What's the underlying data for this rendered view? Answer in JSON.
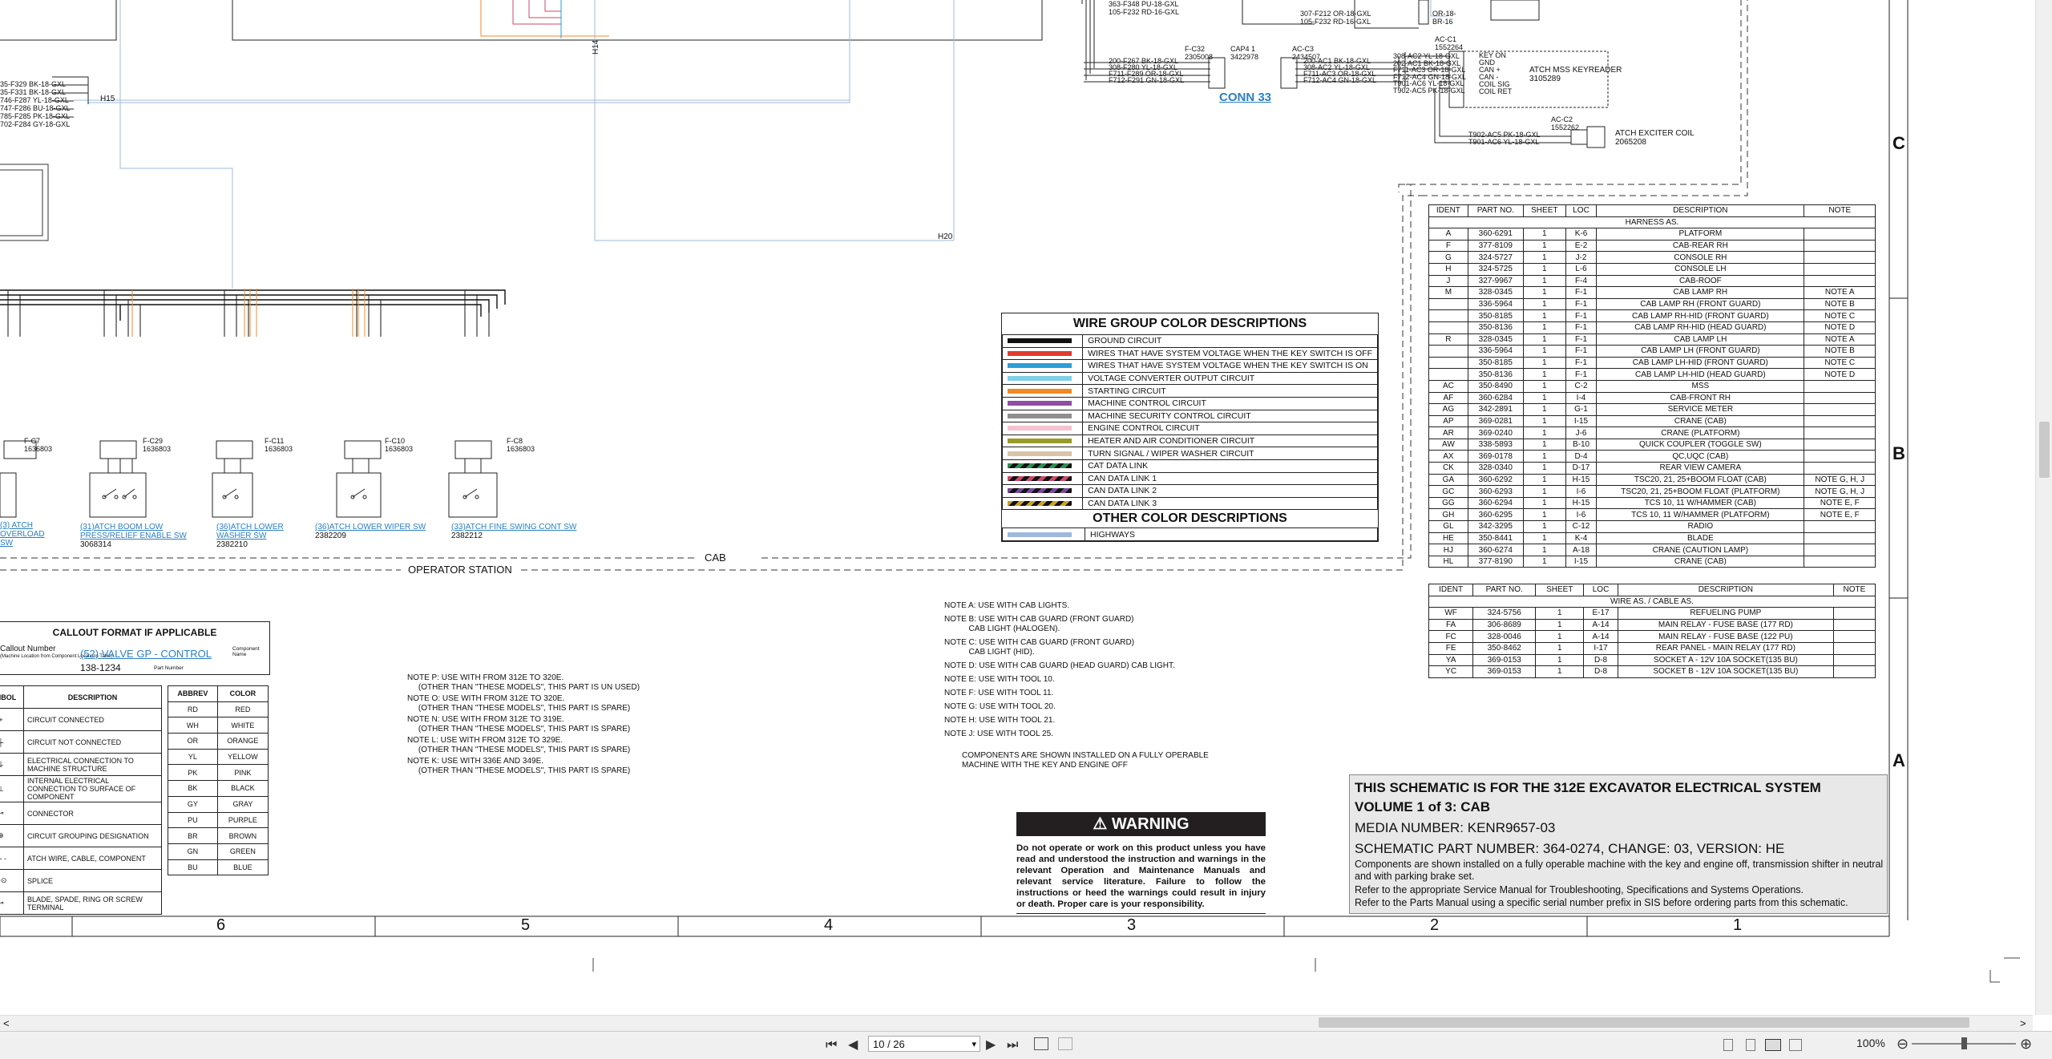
{
  "wire_labels_top_left": [
    "35-F329  BK-18-GXL",
    "35-F331  BK-18-GXL",
    "746-F287  YL-18-GXL",
    "747-F286  BU-18-GXL",
    "785-F285  PK-18-GXL",
    "702-F284  GY-18-GXL"
  ],
  "splice_labels": {
    "h15": "H15",
    "h14": "H14",
    "h20": "H20"
  },
  "top_fragment_labels": [
    "363-F348  PU-18-GXL",
    "105-F232  RD-16-GXL",
    "307-F212  OR-18-GXL",
    "105-F232  RD-16-GXL",
    "OR-18-",
    "BR-16"
  ],
  "conn33": {
    "label": "CONN 33",
    "fc32": "F-C32",
    "fc32_part": "2305008",
    "cap": "CAP4 1",
    "cap_part": "3422978",
    "acc3": "AC-C3",
    "acc3_part": "2434507",
    "left_wires": [
      "200-F267  BK-18-GXL",
      "308-F280  YL-18-GXL",
      "F711-F289  OR-18-GXL",
      "F712-F291  GN-18-GXL"
    ],
    "right_wires": [
      "200-AC1  BK-18-GXL",
      "308-AC2  YL-18-GXL",
      "F711-AC3  OR-18-GXL",
      "F712-AC4  GN-18-GXL"
    ]
  },
  "keyreader": {
    "acc1": "AC-C1",
    "acc1_part": "1552264",
    "wires": [
      "308-AC2  YL-18-GXL",
      "202-AC1  BK-18-GXL",
      "F711-AC3  OR-18-GXL",
      "F712-AC4  GN-18-GXL",
      "T901-AC6  YL-18-GXL",
      "T902-AC5  PK-18-GXL"
    ],
    "pins": [
      "KEY ON",
      "GND",
      "CAN +",
      "CAN -",
      "COIL SIG",
      "COIL RET"
    ],
    "name": "ATCH MSS KEYREADER",
    "part": "3105289",
    "acc2": "AC-C2",
    "acc2_part": "1552262",
    "coil_wires": [
      "T902-AC5  PK-18-GXL",
      "T901-AC6  YL-18-GXL"
    ],
    "coil_name": "ATCH EXCITER COIL",
    "coil_part": "2065208"
  },
  "switches": [
    {
      "fc": "F-C7",
      "part": "1636803",
      "link": "(3) ATCH OVERLOAD SW",
      "num": ""
    },
    {
      "fc": "F-C29",
      "part": "1636803",
      "link": "(31)ATCH BOOM LOW PRESS/RELIEF ENABLE SW",
      "num": "3068314"
    },
    {
      "fc": "F-C11",
      "part": "1636803",
      "link": "(36)ATCH LOWER WASHER SW",
      "num": "2382210"
    },
    {
      "fc": "F-C10",
      "part": "1636803",
      "link": "(36)ATCH LOWER WIPER SW",
      "num": "2382209"
    },
    {
      "fc": "F-C8",
      "part": "1636803",
      "link": "(33)ATCH FINE SWING CONT SW",
      "num": "2382212"
    }
  ],
  "boundary_labels": {
    "cab": "CAB",
    "operator_station": "OPERATOR STATION"
  },
  "wire_group": {
    "title": "WIRE GROUP COLOR DESCRIPTIONS",
    "rows": [
      {
        "color": "#111111",
        "label": "GROUND CIRCUIT",
        "pattern": "solid"
      },
      {
        "color": "#e23b2e",
        "label": "WIRES THAT HAVE SYSTEM VOLTAGE WHEN THE KEY SWITCH IS OFF",
        "pattern": "solid"
      },
      {
        "color": "#2a9fd6",
        "label": "WIRES THAT HAVE SYSTEM VOLTAGE WHEN THE KEY SWITCH IS ON",
        "pattern": "solid"
      },
      {
        "color": "#7fd0e6",
        "label": "VOLTAGE CONVERTER OUTPUT CIRCUIT",
        "pattern": "solid"
      },
      {
        "color": "#f08a24",
        "label": "STARTING CIRCUIT",
        "pattern": "solid"
      },
      {
        "color": "#8e4fa3",
        "label": "MACHINE CONTROL CIRCUIT",
        "pattern": "solid"
      },
      {
        "color": "#8f8f8f",
        "label": "MACHINE SECURITY CONTROL CIRCUIT",
        "pattern": "solid"
      },
      {
        "color": "#f4c3cf",
        "label": "ENGINE CONTROL CIRCUIT",
        "pattern": "solid"
      },
      {
        "color": "#9a9a2a",
        "label": "HEATER AND AIR CONDITIONER CIRCUIT",
        "pattern": "solid"
      },
      {
        "color": "#d8c5a8",
        "label": "TURN SIGNAL / WIPER WASHER CIRCUIT",
        "pattern": "solid"
      },
      {
        "color": "#2f8f4f",
        "label": "CAT DATA LINK",
        "pattern": "stripe"
      },
      {
        "color": "#c94a6a",
        "label": "CAN DATA LINK 1",
        "pattern": "stripe"
      },
      {
        "color": "#7a4a9a",
        "label": "CAN DATA LINK 2",
        "pattern": "stripe"
      },
      {
        "color": "#c9a227",
        "label": "CAN DATA LINK 3",
        "pattern": "stripe"
      }
    ],
    "other_title": "OTHER COLOR DESCRIPTIONS",
    "other_rows": [
      {
        "color": "#9fb8dc",
        "label": "HIGHWAYS"
      }
    ]
  },
  "harness_table": {
    "headers": [
      "IDENT",
      "PART NO.",
      "SHEET",
      "LOC",
      "DESCRIPTION",
      "NOTE"
    ],
    "section": "HARNESS AS.",
    "rows": [
      [
        "A",
        "360-6291",
        "1",
        "K-6",
        "PLATFORM",
        ""
      ],
      [
        "F",
        "377-8109",
        "1",
        "E-2",
        "CAB-REAR RH",
        ""
      ],
      [
        "G",
        "324-5727",
        "1",
        "J-2",
        "CONSOLE RH",
        ""
      ],
      [
        "H",
        "324-5725",
        "1",
        "L-6",
        "CONSOLE LH",
        ""
      ],
      [
        "J",
        "327-9967",
        "1",
        "F-4",
        "CAB-ROOF",
        ""
      ],
      [
        "M",
        "328-0345",
        "1",
        "F-1",
        "CAB LAMP RH",
        "NOTE A"
      ],
      [
        "",
        "336-5964",
        "1",
        "F-1",
        "CAB LAMP RH (FRONT GUARD)",
        "NOTE B"
      ],
      [
        "",
        "350-8185",
        "1",
        "F-1",
        "CAB LAMP RH-HID (FRONT GUARD)",
        "NOTE C"
      ],
      [
        "",
        "350-8136",
        "1",
        "F-1",
        "CAB LAMP RH-HID (HEAD GUARD)",
        "NOTE D"
      ],
      [
        "R",
        "328-0345",
        "1",
        "F-1",
        "CAB LAMP LH",
        "NOTE A"
      ],
      [
        "",
        "336-5964",
        "1",
        "F-1",
        "CAB LAMP LH (FRONT GUARD)",
        "NOTE B"
      ],
      [
        "",
        "350-8185",
        "1",
        "F-1",
        "CAB LAMP LH-HID (FRONT GUARD)",
        "NOTE C"
      ],
      [
        "",
        "350-8136",
        "1",
        "F-1",
        "CAB LAMP LH-HID (HEAD GUARD)",
        "NOTE D"
      ],
      [
        "AC",
        "350-8490",
        "1",
        "C-2",
        "MSS",
        ""
      ],
      [
        "AF",
        "360-6284",
        "1",
        "I-4",
        "CAB-FRONT RH",
        ""
      ],
      [
        "AG",
        "342-2891",
        "1",
        "G-1",
        "SERVICE METER",
        ""
      ],
      [
        "AP",
        "369-0281",
        "1",
        "I-15",
        "CRANE (CAB)",
        ""
      ],
      [
        "AR",
        "369-0240",
        "1",
        "J-6",
        "CRANE (PLATFORM)",
        ""
      ],
      [
        "AW",
        "338-5893",
        "1",
        "B-10",
        "QUICK COUPLER (TOGGLE SW)",
        ""
      ],
      [
        "AX",
        "369-0178",
        "1",
        "D-4",
        "QC,UQC (CAB)",
        ""
      ],
      [
        "CK",
        "328-0340",
        "1",
        "D-17",
        "REAR VIEW CAMERA",
        ""
      ],
      [
        "GA",
        "360-6292",
        "1",
        "H-15",
        "TSC20, 21, 25+BOOM FLOAT (CAB)",
        "NOTE G, H, J"
      ],
      [
        "GC",
        "360-6293",
        "1",
        "I-6",
        "TSC20, 21, 25+BOOM FLOAT (PLATFORM)",
        "NOTE G, H, J"
      ],
      [
        "GG",
        "360-6294",
        "1",
        "H-15",
        "TCS 10, 11 W/HAMMER (CAB)",
        "NOTE E, F"
      ],
      [
        "GH",
        "360-6295",
        "1",
        "I-6",
        "TCS 10, 11 W/HAMMER (PLATFORM)",
        "NOTE E, F"
      ],
      [
        "GL",
        "342-3295",
        "1",
        "C-12",
        "RADIO",
        ""
      ],
      [
        "HE",
        "350-8441",
        "1",
        "K-4",
        "BLADE",
        ""
      ],
      [
        "HJ",
        "360-6274",
        "1",
        "A-18",
        "CRANE (CAUTION LAMP)",
        ""
      ],
      [
        "HL",
        "377-8190",
        "1",
        "I-15",
        "CRANE (CAB)",
        ""
      ]
    ]
  },
  "wire_table": {
    "headers": [
      "IDENT",
      "PART NO.",
      "SHEET",
      "LOC",
      "DESCRIPTION",
      "NOTE"
    ],
    "section": "WIRE AS. / CABLE AS.",
    "rows": [
      [
        "WF",
        "324-5756",
        "1",
        "E-17",
        "REFUELING PUMP",
        ""
      ],
      [
        "FA",
        "306-8689",
        "1",
        "A-14",
        "MAIN RELAY - FUSE BASE (177 RD)",
        ""
      ],
      [
        "FC",
        "328-0046",
        "1",
        "A-14",
        "MAIN RELAY - FUSE BASE (122 PU)",
        ""
      ],
      [
        "FE",
        "350-8462",
        "1",
        "I-17",
        "REAR PANEL - MAIN RELAY (177 RD)",
        ""
      ],
      [
        "YA",
        "369-0153",
        "1",
        "D-8",
        "SOCKET A - 12V 10A SOCKET(135 BU)",
        ""
      ],
      [
        "YC",
        "369-0153",
        "1",
        "D-8",
        "SOCKET B - 12V 10A SOCKET(135 BU)",
        ""
      ]
    ]
  },
  "callout": {
    "title": "CALLOUT FORMAT IF APPLICABLE",
    "callout_number": "Callout Number",
    "callout_sub": "(Machine Location from Component Locations Table)",
    "link": "(52) VALVE GP - CONTROL",
    "component_name": "Component Name",
    "part_number": "138-1234",
    "part_label": "Part Number"
  },
  "symbols": {
    "headers": [
      "SYMBOL",
      "DESCRIPTION"
    ],
    "rows": [
      "CIRCUIT CONNECTED",
      "CIRCUIT NOT CONNECTED",
      "ELECTRICAL CONNECTION TO MACHINE STRUCTURE",
      "INTERNAL ELECTRICAL CONNECTION TO SURFACE OF COMPONENT",
      "CONNECTOR",
      "CIRCUIT GROUPING DESIGNATION",
      "ATCH WIRE, CABLE, COMPONENT",
      "SPLICE",
      "BLADE, SPADE, RING OR SCREW TERMINAL"
    ]
  },
  "abbrev": {
    "headers": [
      "ABBREV",
      "COLOR"
    ],
    "rows": [
      [
        "RD",
        "RED"
      ],
      [
        "WH",
        "WHITE"
      ],
      [
        "OR",
        "ORANGE"
      ],
      [
        "YL",
        "YELLOW"
      ],
      [
        "PK",
        "PINK"
      ],
      [
        "BK",
        "BLACK"
      ],
      [
        "GY",
        "GRAY"
      ],
      [
        "PU",
        "PURPLE"
      ],
      [
        "BR",
        "BROWN"
      ],
      [
        "GN",
        "GREEN"
      ],
      [
        "BU",
        "BLUE"
      ]
    ]
  },
  "model_notes": [
    "NOTE P: USE WITH FROM 312E TO 320E.\n     (OTHER THAN \"THESE MODELS\", THIS PART IS UN USED)",
    "NOTE O: USE WITH FROM 312E TO 320E.\n     (OTHER THAN \"THESE MODELS\", THIS PART IS SPARE)",
    "NOTE N: USE WITH FROM 312E TO 319E.\n     (OTHER THAN \"THESE MODELS\", THIS PART IS SPARE)",
    "NOTE L: USE WITH FROM 312E TO 329E.\n     (OTHER THAN \"THESE MODELS\", THIS PART IS SPARE)",
    "NOTE K: USE WITH 336E AND 349E.\n     (OTHER THAN \"THESE MODELS\", THIS PART IS SPARE)"
  ],
  "cab_notes": [
    "NOTE A: USE WITH CAB LIGHTS.",
    "NOTE B: USE WITH CAB GUARD (FRONT GUARD)\n           CAB LIGHT (HALOGEN).",
    "NOTE C: USE WITH CAB GUARD (FRONT GUARD)\n           CAB LIGHT (HID).",
    "NOTE D: USE WITH CAB GUARD (HEAD GUARD) CAB LIGHT.",
    "NOTE E: USE WITH TOOL 10.",
    "NOTE F: USE WITH TOOL 11.",
    "NOTE G: USE WITH TOOL 20.",
    "NOTE H: USE WITH TOOL 21.",
    "NOTE J: USE WITH TOOL 25."
  ],
  "components_note": "COMPONENTS ARE SHOWN INSTALLED ON A FULLY OPERABLE\nMACHINE WITH THE KEY AND ENGINE OFF",
  "warning": {
    "title": "WARNING",
    "text": "Do not operate or work on this product unless you have read and understood the instruction and warnings in the relevant Operation and Maintenance Manuals and relevant service literature. Failure to follow the instructions or heed the warnings could result in injury or death. Proper care is your responsibility."
  },
  "info": {
    "line1": "THIS SCHEMATIC IS FOR THE 312E EXCAVATOR ELECTRICAL SYSTEM",
    "line2": "VOLUME 1 of 3: CAB",
    "line3": "MEDIA NUMBER: KENR9657-03",
    "line4": "SCHEMATIC PART NUMBER: 364-0274, CHANGE: 03, VERSION: HE",
    "line5": "Components are shown installed on a fully operable machine with the key and engine off, transmission shifter in neutral and with parking brake set.",
    "line6": "Refer to the appropriate Service Manual for Troubleshooting, Specifications and Systems Operations.",
    "line7": "Refer to the Parts Manual using a specific serial number prefix in SIS before ordering parts from this schematic."
  },
  "grid_numbers": [
    "6",
    "5",
    "4",
    "3",
    "2",
    "1"
  ],
  "grid_letters": [
    "C",
    "B",
    "A"
  ],
  "viewer": {
    "page_value": "10 / 26",
    "zoom": "100%",
    "scroll_left": "<",
    "scroll_right": ">",
    "first": "⏮",
    "prev": "◀",
    "next": "▶",
    "last": "⏭",
    "dropdown": "▾",
    "zoom_out": "⊖",
    "zoom_in": "⊕"
  }
}
